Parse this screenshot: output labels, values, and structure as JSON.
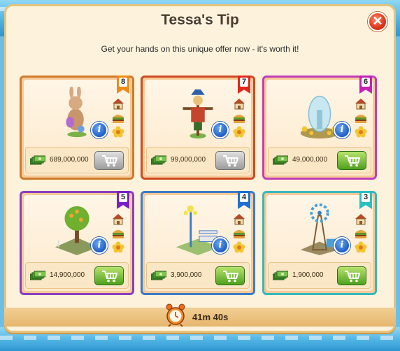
{
  "dialog": {
    "title": "Tessa's Tip",
    "subtitle": "Get your hands on this unique offer now - it's worth it!",
    "close_symbol": "✕",
    "timer": "41m 40s"
  },
  "offers": [
    {
      "rank": "8",
      "ribbon_color": "#f08a16",
      "border_color": "#d07a2a",
      "item_icon": "bunny-statue-icon",
      "price": "689,000,000",
      "cart_state": "disabled",
      "info_symbol": "i"
    },
    {
      "rank": "7",
      "ribbon_color": "#e0281a",
      "border_color": "#cd4b22",
      "item_icon": "scarecrow-icon",
      "price": "99,000,000",
      "cart_state": "disabled",
      "info_symbol": "i"
    },
    {
      "rank": "6",
      "ribbon_color": "#c81fb9",
      "border_color": "#c23eb8",
      "item_icon": "glass-dome-fountain-icon",
      "price": "49,000,000",
      "cart_state": "enabled",
      "info_symbol": "i"
    },
    {
      "rank": "5",
      "ribbon_color": "#7a1fc6",
      "border_color": "#8a3ec0",
      "item_icon": "fruit-tree-garden-icon",
      "price": "14,900,000",
      "cart_state": "enabled",
      "info_symbol": "i"
    },
    {
      "rank": "4",
      "ribbon_color": "#1f6fd0",
      "border_color": "#3d7bc7",
      "item_icon": "lamp-post-bench-icon",
      "price": "3,900,000",
      "cart_state": "enabled",
      "info_symbol": "i"
    },
    {
      "rank": "3",
      "ribbon_color": "#28c0c4",
      "border_color": "#39b8bc",
      "item_icon": "windmill-pump-icon",
      "price": "1,900,000",
      "cart_state": "enabled",
      "info_symbol": "i"
    }
  ]
}
